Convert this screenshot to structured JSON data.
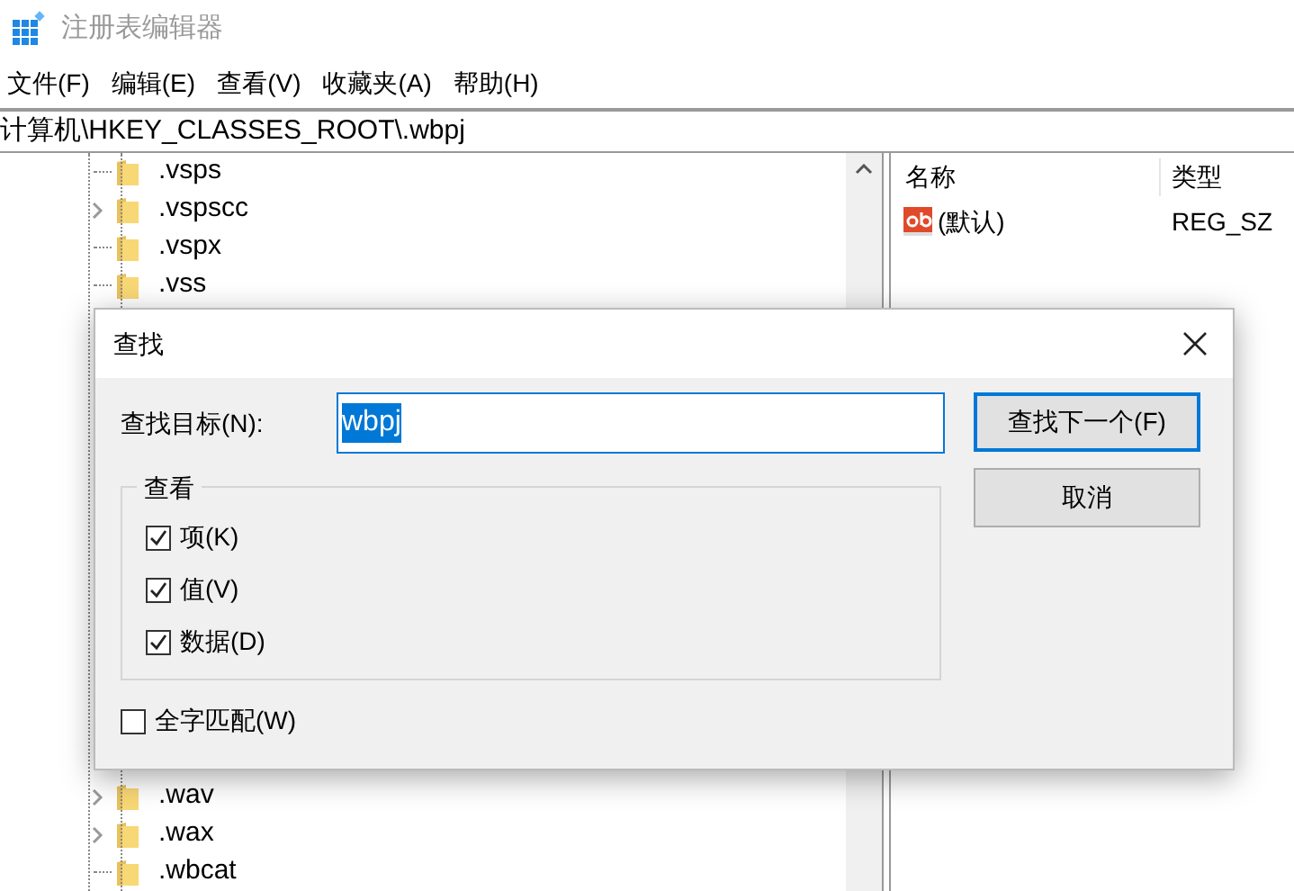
{
  "window": {
    "title": "注册表编辑器"
  },
  "menu": [
    {
      "label": "文件(F)"
    },
    {
      "label": "编辑(E)"
    },
    {
      "label": "查看(V)"
    },
    {
      "label": "收藏夹(A)"
    },
    {
      "label": "帮助(H)"
    }
  ],
  "address": "计算机\\HKEY_CLASSES_ROOT\\.wbpj",
  "tree_top": [
    {
      "label": ".vsps",
      "expandable": false
    },
    {
      "label": ".vspscc",
      "expandable": true
    },
    {
      "label": ".vspx",
      "expandable": false
    },
    {
      "label": ".vss",
      "expandable": false
    }
  ],
  "tree_bottom": [
    {
      "label": ".wav",
      "expandable": true
    },
    {
      "label": ".wax",
      "expandable": true
    },
    {
      "label": ".wbcat",
      "expandable": false
    }
  ],
  "values": {
    "columns": [
      "名称",
      "类型"
    ],
    "rows": [
      {
        "name": "(默认)",
        "type": "REG_SZ"
      }
    ]
  },
  "dialog": {
    "title": "查找",
    "target_label": "查找目标(N):",
    "target_value": "wbpj",
    "group_title": "查看",
    "options": [
      {
        "label": "项(K)",
        "checked": true
      },
      {
        "label": "值(V)",
        "checked": true
      },
      {
        "label": "数据(D)",
        "checked": true
      }
    ],
    "whole_word": {
      "label": "全字匹配(W)",
      "checked": false
    },
    "buttons": [
      {
        "label": "查找下一个(F)",
        "default": true
      },
      {
        "label": "取消",
        "default": false
      }
    ]
  }
}
